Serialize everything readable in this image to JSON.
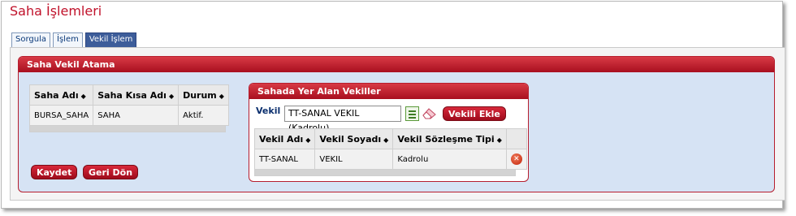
{
  "page": {
    "title": "Saha İşlemleri"
  },
  "tabs": [
    {
      "label": "Sorgula",
      "active": false
    },
    {
      "label": "İşlem",
      "active": false
    },
    {
      "label": "Vekil İşlem",
      "active": true
    }
  ],
  "section": {
    "title": "Saha Vekil Atama",
    "field_grid": {
      "columns": [
        "Saha Adı",
        "Saha Kısa Adı",
        "Durum"
      ],
      "rows": [
        [
          "BURSA_SAHA",
          "SAHA",
          "Aktif."
        ]
      ]
    },
    "buttons": {
      "save": "Kaydet",
      "back": "Geri Dön"
    }
  },
  "vekil_panel": {
    "title": "Sahada Yer Alan Vekiller",
    "vekil_label": "Vekil",
    "vekil_value": "TT-SANAL VEKIL (Kadrolu)",
    "add_button": "Vekili Ekle",
    "grid": {
      "columns": [
        "Vekil Adı",
        "Vekil Soyadı",
        "Vekil Sözleşme Tipi"
      ],
      "rows": [
        [
          "TT-SANAL",
          "VEKIL",
          "Kadrolu"
        ]
      ]
    }
  },
  "icons": {
    "sort": "sort-icon",
    "list": "list-icon",
    "eraser": "eraser-icon",
    "delete": "delete-icon"
  },
  "colors": {
    "accent": "#c0112a",
    "panel": "#d6e3f4",
    "tab_active": "#3d5d9a"
  }
}
